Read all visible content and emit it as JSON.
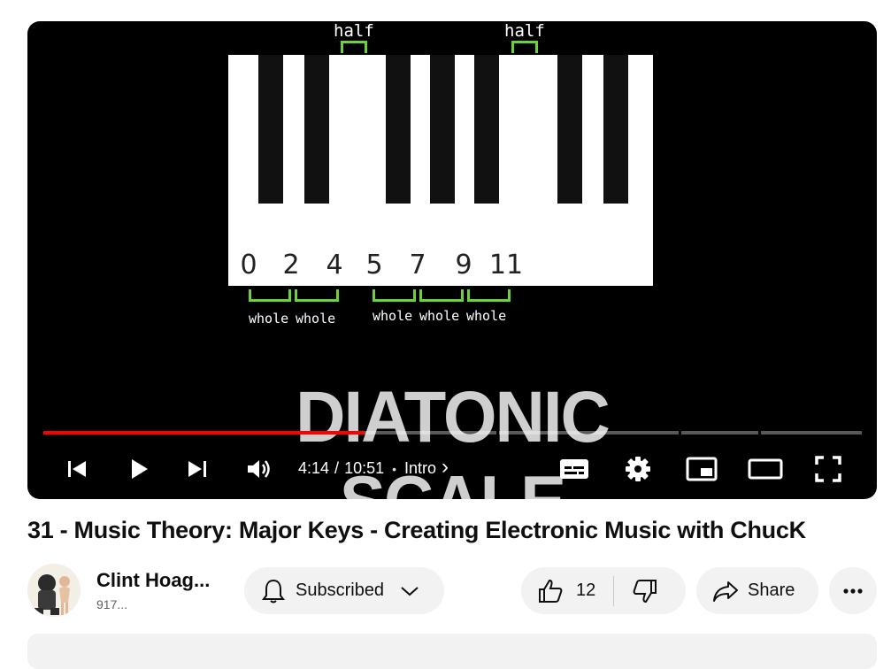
{
  "video": {
    "overlay": {
      "half_labels": [
        "half",
        "half"
      ],
      "key_numbers": [
        "0",
        "2",
        "4",
        "5",
        "7",
        "9",
        "11"
      ],
      "whole_labels": [
        "whole",
        "whole",
        "whole",
        "whole",
        "whole"
      ],
      "scale_title": "DIATONIC SCALE"
    },
    "progress_fraction": 0.392,
    "time": {
      "current": "4:14",
      "separator": "/",
      "duration": "10:51",
      "bullet": "•",
      "chapter": "Intro",
      "chevron": "›"
    },
    "controls": {
      "previous_icon": "skip-previous-icon",
      "play_icon": "play-icon",
      "next_icon": "skip-next-icon",
      "volume_icon": "volume-icon",
      "captions_icon": "subtitles-icon",
      "settings_icon": "gear-icon",
      "miniplayer_icon": "miniplayer-icon",
      "theater_icon": "theater-mode-icon",
      "fullscreen_icon": "fullscreen-icon"
    },
    "accent_color": "#ff0000"
  },
  "title": "31 - Music Theory: Major Keys - Creating Electronic Music with ChucK",
  "channel": {
    "name": "Clint Hoag...",
    "subscribers": "917..."
  },
  "actions": {
    "subscribe_label": "Subscribed",
    "like_count": "12",
    "share_label": "Share"
  }
}
